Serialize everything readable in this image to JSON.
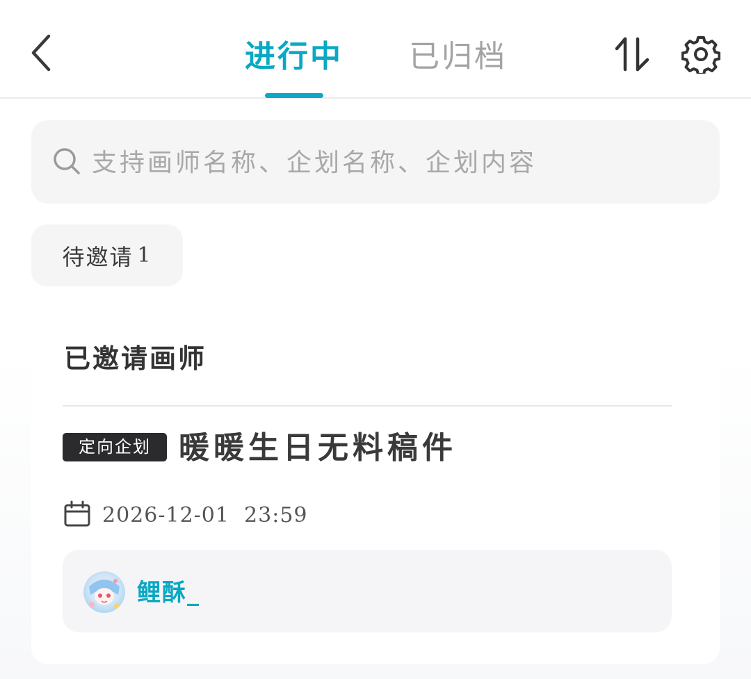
{
  "header": {
    "tabs": [
      {
        "label": "进行中",
        "active": true
      },
      {
        "label": "已归档",
        "active": false
      }
    ],
    "icons": {
      "back": "chevron-left-icon",
      "sort": "sort-arrows-icon",
      "settings": "gear-icon"
    }
  },
  "search": {
    "placeholder": "支持画师名称、企划名称、企划内容",
    "value": ""
  },
  "filters": [
    {
      "label": "待邀请",
      "count": "1"
    }
  ],
  "section": {
    "title": "已邀请画师"
  },
  "project": {
    "tag": "定向企划",
    "title": "暖暖生日无料稿件",
    "deadline": "2026-12-01  23:59",
    "artist": {
      "name": "鲤酥_"
    }
  },
  "colors": {
    "accent": "#0aa8c4",
    "tag_bg": "#2b2b2e",
    "surface": "#f5f5f5"
  }
}
